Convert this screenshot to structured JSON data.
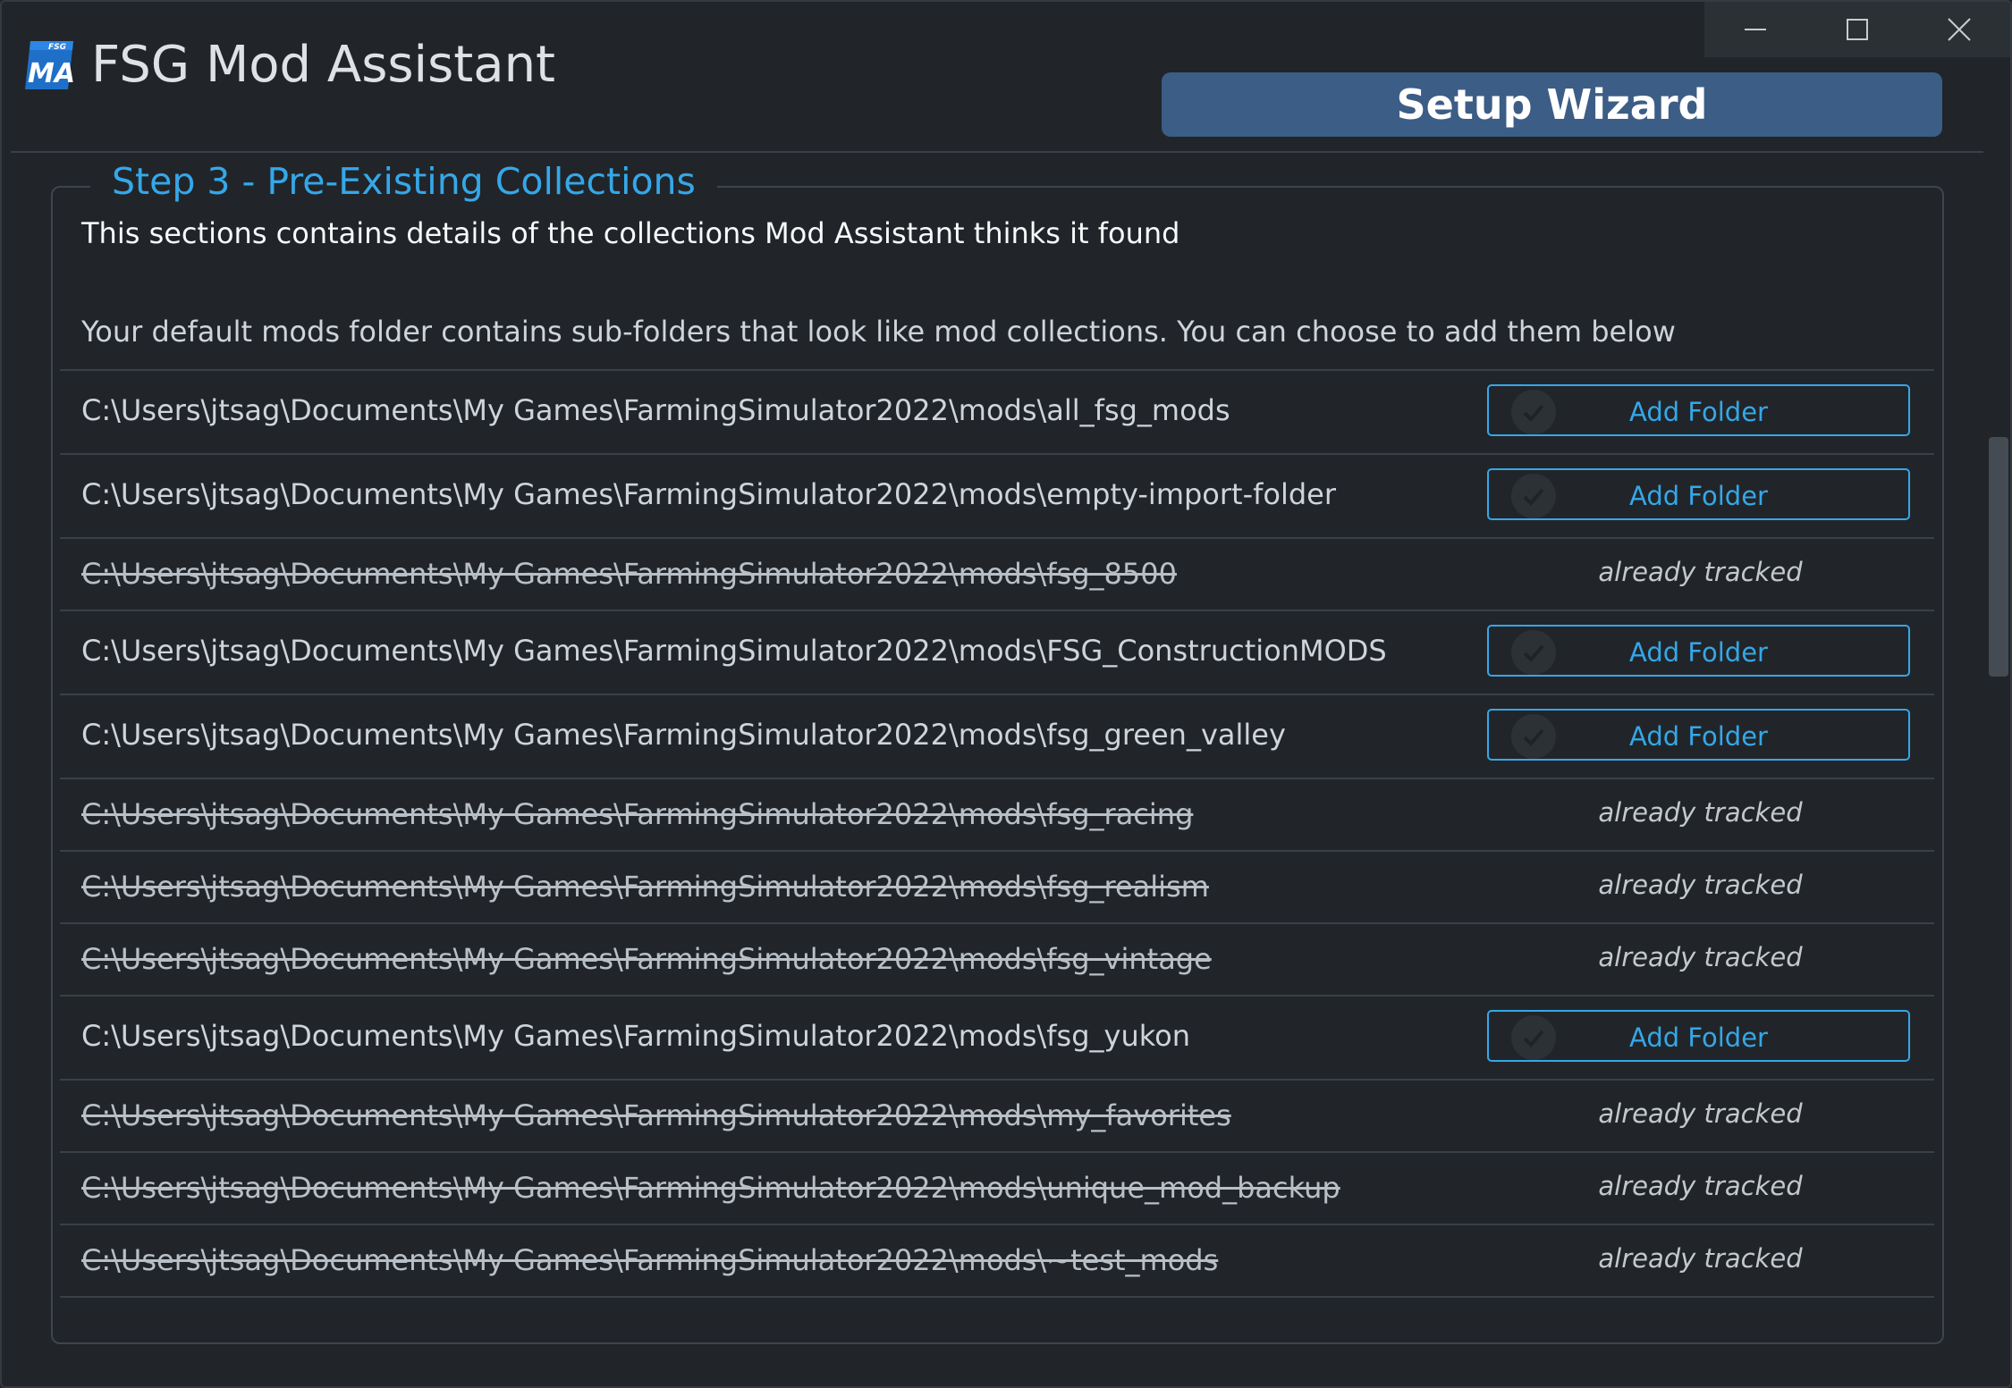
{
  "app": {
    "logo_text_top": "FSG",
    "logo_text_main": "MA",
    "title": "FSG Mod Assistant",
    "wizard_title": "Setup Wizard"
  },
  "window_controls": {
    "minimize_icon": "minimize-icon",
    "maximize_icon": "maximize-icon",
    "close_icon": "close-icon"
  },
  "step": {
    "title": "Step 3 - Pre-Existing Collections",
    "intro": "This sections contains details of the collections Mod Assistant thinks it found",
    "subintro": "Your default mods folder contains sub-folders that look like mod collections. You can choose to add them below"
  },
  "colors": {
    "accent": "#35a7e8",
    "wizard_bg": "#3c5d86",
    "background": "#212529"
  },
  "folders": [
    {
      "path": "C:\\Users\\jtsag\\Documents\\My Games\\FarmingSimulator2022\\mods\\all_fsg_mods",
      "action": "Add Folder"
    },
    {
      "path": "C:\\Users\\jtsag\\Documents\\My Games\\FarmingSimulator2022\\mods\\empty-import-folder",
      "action": "Add Folder"
    },
    {
      "path": "C:\\Users\\jtsag\\Documents\\My Games\\FarmingSimulator2022\\mods\\fsg_8500",
      "status": "already tracked"
    },
    {
      "path": "C:\\Users\\jtsag\\Documents\\My Games\\FarmingSimulator2022\\mods\\FSG_ConstructionMODS",
      "action": "Add Folder"
    },
    {
      "path": "C:\\Users\\jtsag\\Documents\\My Games\\FarmingSimulator2022\\mods\\fsg_green_valley",
      "action": "Add Folder"
    },
    {
      "path": "C:\\Users\\jtsag\\Documents\\My Games\\FarmingSimulator2022\\mods\\fsg_racing",
      "status": "already tracked"
    },
    {
      "path": "C:\\Users\\jtsag\\Documents\\My Games\\FarmingSimulator2022\\mods\\fsg_realism",
      "status": "already tracked"
    },
    {
      "path": "C:\\Users\\jtsag\\Documents\\My Games\\FarmingSimulator2022\\mods\\fsg_vintage",
      "status": "already tracked"
    },
    {
      "path": "C:\\Users\\jtsag\\Documents\\My Games\\FarmingSimulator2022\\mods\\fsg_yukon",
      "action": "Add Folder"
    },
    {
      "path": "C:\\Users\\jtsag\\Documents\\My Games\\FarmingSimulator2022\\mods\\my_favorites",
      "status": "already tracked"
    },
    {
      "path": "C:\\Users\\jtsag\\Documents\\My Games\\FarmingSimulator2022\\mods\\unique_mod_backup",
      "status": "already tracked"
    },
    {
      "path": "C:\\Users\\jtsag\\Documents\\My Games\\FarmingSimulator2022\\mods\\~test_mods",
      "status": "already tracked"
    }
  ]
}
